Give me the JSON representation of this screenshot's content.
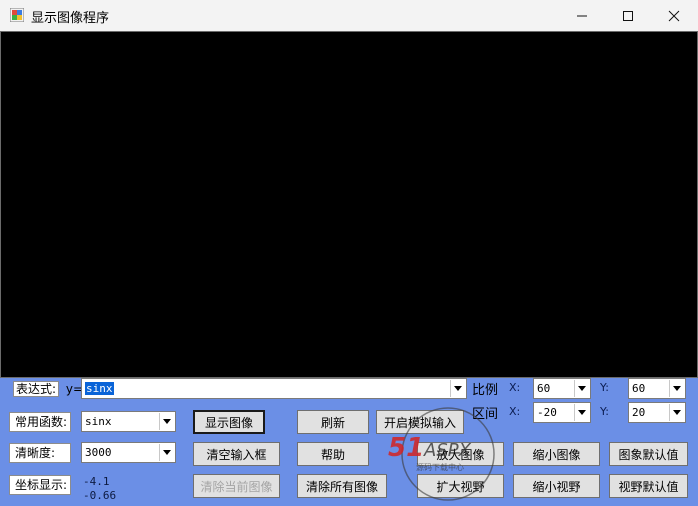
{
  "window": {
    "title": "显示图像程序",
    "controls": {
      "minimize": "minimize",
      "maximize": "maximize",
      "close": "close"
    }
  },
  "expression": {
    "label": "表达式:",
    "y_label": "y=",
    "value": "sinx"
  },
  "functions": {
    "label": "常用函数:",
    "value": "sinx"
  },
  "resolution": {
    "label": "清晰度:",
    "value": "3000"
  },
  "coord_display": {
    "label": "坐标显示:",
    "x": "-4.1",
    "y": "-0.66"
  },
  "scale": {
    "label": "比例",
    "x_label": "X:",
    "x_value": "60",
    "y_label": "Y:",
    "y_value": "60"
  },
  "interval": {
    "label": "区间",
    "x_label": "X:",
    "x_value": "-20",
    "y_label": "Y:",
    "y_value": "20"
  },
  "buttons": {
    "show_image": "显示图像",
    "refresh": "刷新",
    "simulate_input": "开启模拟输入",
    "clear_input": "清空输入框",
    "help": "帮助",
    "zoom_in_image": "放大图像",
    "zoom_out_image": "缩小图像",
    "image_default": "图象默认值",
    "clear_current": "清除当前图像",
    "clear_all": "清除所有图像",
    "enlarge_view": "扩大视野",
    "shrink_view": "缩小视野",
    "view_default": "视野默认值"
  },
  "watermark": {
    "text": "51ASPX",
    "subtext": "源码下载中心"
  },
  "colors": {
    "canvas": "#000000",
    "panel": "#6b8fe6",
    "selection": "#0a64d8"
  }
}
